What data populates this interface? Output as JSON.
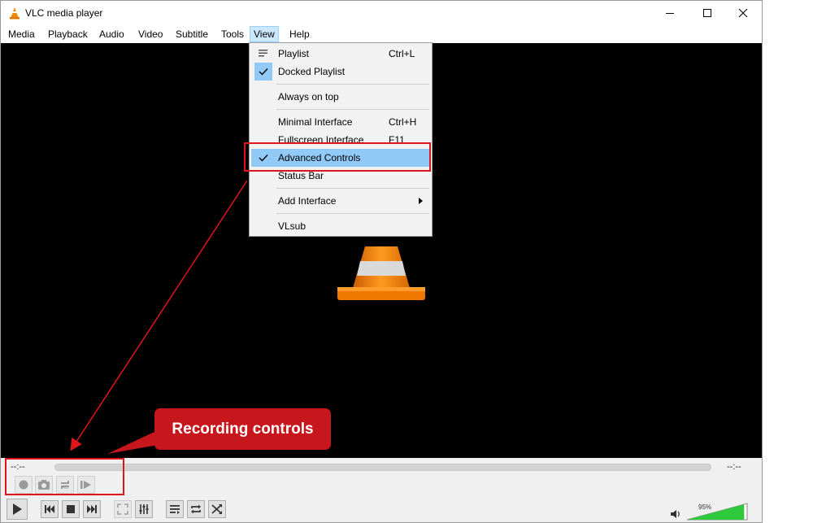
{
  "window": {
    "title": "VLC media player"
  },
  "menu": {
    "items": [
      "Media",
      "Playback",
      "Audio",
      "Video",
      "Subtitle",
      "Tools",
      "View",
      "Help"
    ],
    "open": "View"
  },
  "view_menu": {
    "items": [
      {
        "label": "Playlist",
        "shortcut": "Ctrl+L",
        "checked": false,
        "icon": "playlist-icon"
      },
      {
        "label": "Docked Playlist",
        "shortcut": "",
        "checked": true
      },
      {
        "label": "Always on top",
        "shortcut": "",
        "checked": false
      },
      {
        "label": "Minimal Interface",
        "shortcut": "Ctrl+H",
        "checked": false
      },
      {
        "label": "Fullscreen Interface",
        "shortcut": "F11",
        "checked": false
      },
      {
        "label": "Advanced Controls",
        "shortcut": "",
        "checked": true,
        "highlighted": true
      },
      {
        "label": "Status Bar",
        "shortcut": "",
        "checked": false
      },
      {
        "label": "Add Interface",
        "shortcut": "",
        "submenu": true
      },
      {
        "label": "VLsub",
        "shortcut": ""
      }
    ]
  },
  "player": {
    "time_elapsed": "--:--",
    "time_total": "--:--",
    "volume": "95%",
    "volume_level": 0.95
  },
  "annotation": {
    "callout": "Recording controls"
  },
  "colors": {
    "accent": "#91c9f7",
    "callout": "#c8161d",
    "annotation_red": "#e0141b",
    "volume_green": "#2fc93d"
  }
}
